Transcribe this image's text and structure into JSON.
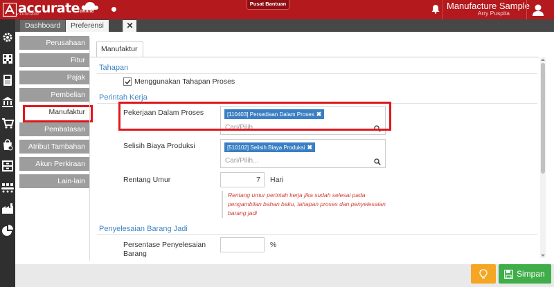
{
  "app": {
    "logo_text": "accurate",
    "logo_sub": "online",
    "version": "v 1.0.0#12030",
    "help_button": "Pusat Bantuan",
    "company": "Manufacture Sample",
    "user": "Arry Puspita",
    "brand_color": "#b3191d"
  },
  "tabs": {
    "dashboard": "Dashboard",
    "preferences": "Preferensi",
    "close": "✕",
    "count": "2"
  },
  "icons": [
    "gear-icon",
    "building-icon",
    "calculator-icon",
    "bank-icon",
    "cart-icon",
    "bag-icon",
    "inventory-icon",
    "conveyor-icon",
    "factory-icon",
    "pie-chart-icon"
  ],
  "left_menu": {
    "items": [
      {
        "label": "Perusahaan"
      },
      {
        "label": "Fitur"
      },
      {
        "label": "Pajak"
      },
      {
        "label": "Pembelian"
      },
      {
        "label": "Manufaktur"
      },
      {
        "label": "Pembatasan"
      },
      {
        "label": "Atribut Tambahan"
      },
      {
        "label": "Akun Perkiraan"
      },
      {
        "label": "Lain-lain"
      }
    ],
    "active_index": 4
  },
  "subtab": "Manufaktur",
  "sections": {
    "tahapan": {
      "title": "Tahapan",
      "checkbox_label": "Menggunakan Tahapan Proses",
      "checked": true
    },
    "perintah_kerja": {
      "title": "Perintah Kerja",
      "wip": {
        "label": "Pekerjaan Dalam Proses",
        "tag": "[110403] Persediaan Dalam Proses",
        "placeholder": "Cari/Pilih..."
      },
      "selisih": {
        "label": "Selisih Biaya Produksi",
        "tag": "[510102] Selisih Biaya Produksi",
        "placeholder": "Cari/Pilih..."
      },
      "rentang": {
        "label": "Rentang Umur",
        "value": "7",
        "unit": "Hari",
        "note": "Rentang umur perintah kerja jika sudah selesai pada pengambilan bahan baku, tahapan proses dan penyelesaian barang jadi"
      }
    },
    "penyelesaian": {
      "title": "Penyelesaian Barang Jadi",
      "persentase_label": "Persentase Penyelesaian Barang",
      "persentase_value": "",
      "unit": "%"
    }
  },
  "buttons": {
    "save": "Simpan",
    "tip_color": "#f5a623",
    "save_color": "#3fae49"
  }
}
